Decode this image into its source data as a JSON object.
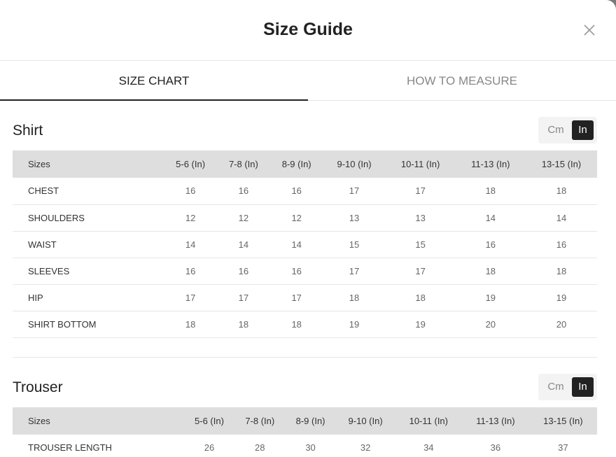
{
  "modal": {
    "title": "Size Guide",
    "close_icon": "close-icon"
  },
  "tabs": [
    {
      "label": "SIZE CHART",
      "active": true
    },
    {
      "label": "HOW TO MEASURE",
      "active": false
    }
  ],
  "unit_toggle": {
    "cm_label": "Cm",
    "in_label": "In",
    "selected": "In"
  },
  "shirt": {
    "title": "Shirt",
    "headers": [
      "Sizes",
      "5-6 (In)",
      "7-8 (In)",
      "8-9 (In)",
      "9-10 (In)",
      "10-11 (In)",
      "11-13 (In)",
      "13-15 (In)"
    ],
    "rows": [
      [
        "CHEST",
        "16",
        "16",
        "16",
        "17",
        "17",
        "18",
        "18"
      ],
      [
        "SHOULDERS",
        "12",
        "12",
        "12",
        "13",
        "13",
        "14",
        "14"
      ],
      [
        "WAIST",
        "14",
        "14",
        "14",
        "15",
        "15",
        "16",
        "16"
      ],
      [
        "SLEEVES",
        "16",
        "16",
        "16",
        "17",
        "17",
        "18",
        "18"
      ],
      [
        "HIP",
        "17",
        "17",
        "17",
        "18",
        "18",
        "19",
        "19"
      ],
      [
        "SHIRT BOTTOM",
        "18",
        "18",
        "18",
        "19",
        "19",
        "20",
        "20"
      ]
    ]
  },
  "trouser": {
    "title": "Trouser",
    "headers": [
      "Sizes",
      "5-6 (In)",
      "7-8 (In)",
      "8-9 (In)",
      "9-10 (In)",
      "10-11 (In)",
      "11-13 (In)",
      "13-15 (In)"
    ],
    "rows": [
      [
        "TROUSER LENGTH",
        "26",
        "28",
        "30",
        "32",
        "34",
        "36",
        "37"
      ]
    ]
  }
}
